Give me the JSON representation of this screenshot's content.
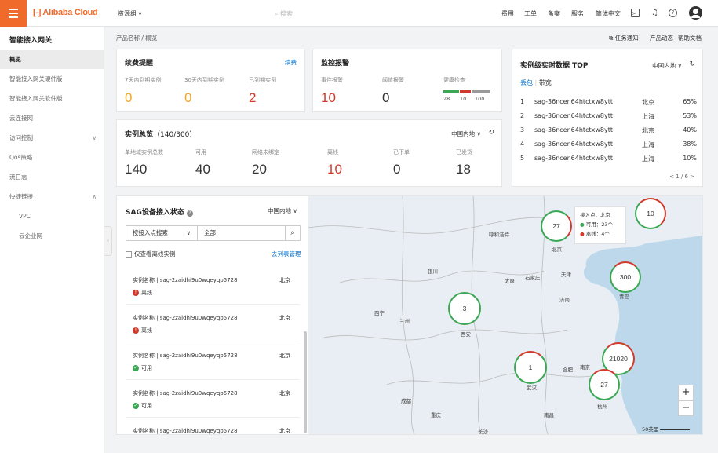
{
  "topbar": {
    "logo": "[-] Alibaba Cloud",
    "resource_group": "资源组 ▾",
    "search_placeholder": "搜索",
    "nav": [
      "费用",
      "工单",
      "备案",
      "服务",
      "简体中文"
    ]
  },
  "sidebar": {
    "title": "智能接入网关",
    "items": [
      {
        "label": "概览"
      },
      {
        "label": "智能接入网关硬件版"
      },
      {
        "label": "智能接入网关软件版"
      },
      {
        "label": "云连接网"
      },
      {
        "label": "访问控制"
      },
      {
        "label": "Qos策略"
      },
      {
        "label": "流日志"
      },
      {
        "label": "快捷链接"
      },
      {
        "label": "VPC"
      },
      {
        "label": "云企业网"
      }
    ]
  },
  "breadcrumb": "产品名称 / 概览",
  "topright": {
    "task": "任务通知",
    "news": "产品动态",
    "help": "帮助文档"
  },
  "renew": {
    "title": "续费提醒",
    "link": "续费",
    "items": [
      {
        "label": "7天内到期实例",
        "value": "0"
      },
      {
        "label": "30天内到期实例",
        "value": "0"
      },
      {
        "label": "已到期实例",
        "value": "2"
      }
    ]
  },
  "monitor": {
    "title": "监控报警",
    "items": [
      {
        "label": "事件报警",
        "value": "10"
      },
      {
        "label": "阈值报警",
        "value": "0"
      }
    ],
    "health": {
      "label": "健康检查",
      "values": [
        "28",
        "10",
        "100"
      ]
    }
  },
  "instances": {
    "title": "实例总览",
    "count": "（140/300）",
    "region": "中国内地",
    "items": [
      {
        "label": "单地域实例总数",
        "value": "140"
      },
      {
        "label": "可用",
        "value": "40"
      },
      {
        "label": "网络未绑定",
        "value": "20"
      },
      {
        "label": "离线",
        "value": "10"
      },
      {
        "label": "已下单",
        "value": "0"
      },
      {
        "label": "已发货",
        "value": "18"
      }
    ]
  },
  "top": {
    "title": "实例级实时数据 TOP",
    "region": "中国内地",
    "tab_loss": "丢包",
    "tab_bw": "带宽",
    "pager": "< 1 / 6 >",
    "rows": [
      {
        "n": "1",
        "name": "sag-36ncen64htctxw8ytt",
        "city": "北京",
        "pct": "65%"
      },
      {
        "n": "2",
        "name": "sag-36ncen64htctxw8ytt",
        "city": "上海",
        "pct": "53%"
      },
      {
        "n": "3",
        "name": "sag-36ncen64htctxw8ytt",
        "city": "北京",
        "pct": "40%"
      },
      {
        "n": "4",
        "name": "sag-36ncen64htctxw8ytt",
        "city": "上海",
        "pct": "38%"
      },
      {
        "n": "5",
        "name": "sag-36ncen64htctxw8ytt",
        "city": "上海",
        "pct": "10%"
      }
    ]
  },
  "sag": {
    "title": "SAG设备接入状态",
    "region": "中国内地",
    "search_by": "按接入点搜索",
    "filter": "全部",
    "only_offline": "仅查看离线实例",
    "list_mgmt": "去列表管理",
    "list": [
      {
        "name": "实例名称 | sag-2zaidhi9u0wqeyqp5728",
        "city": "北京",
        "status": "离线",
        "ok": false
      },
      {
        "name": "实例名称 | sag-2zaidhi9u0wqeyqp5728",
        "city": "北京",
        "status": "离线",
        "ok": false
      },
      {
        "name": "实例名称 | sag-2zaidhi9u0wqeyqp5728",
        "city": "北京",
        "status": "可用",
        "ok": true
      },
      {
        "name": "实例名称 | sag-2zaidhi9u0wqeyqp5728",
        "city": "北京",
        "status": "可用",
        "ok": true
      },
      {
        "name": "实例名称 | sag-2zaidhi9u0wqeyqp5728",
        "city": "北京",
        "status": "",
        "ok": true
      }
    ]
  },
  "map": {
    "clusters": [
      "27",
      "10",
      "300",
      "3",
      "1",
      "21020",
      "27"
    ],
    "cities": [
      "呼和浩特",
      "北京",
      "天津",
      "银川",
      "太原",
      "石家庄",
      "济南",
      "西宁",
      "兰州",
      "西安",
      "青岛",
      "武汉",
      "合肥",
      "南京",
      "成都",
      "重庆",
      "杭州",
      "南昌",
      "长沙"
    ],
    "tooltip": {
      "title": "接入点：北京",
      "ok": "可用：23个",
      "off": "离线：4个"
    },
    "scale": "50英里"
  }
}
